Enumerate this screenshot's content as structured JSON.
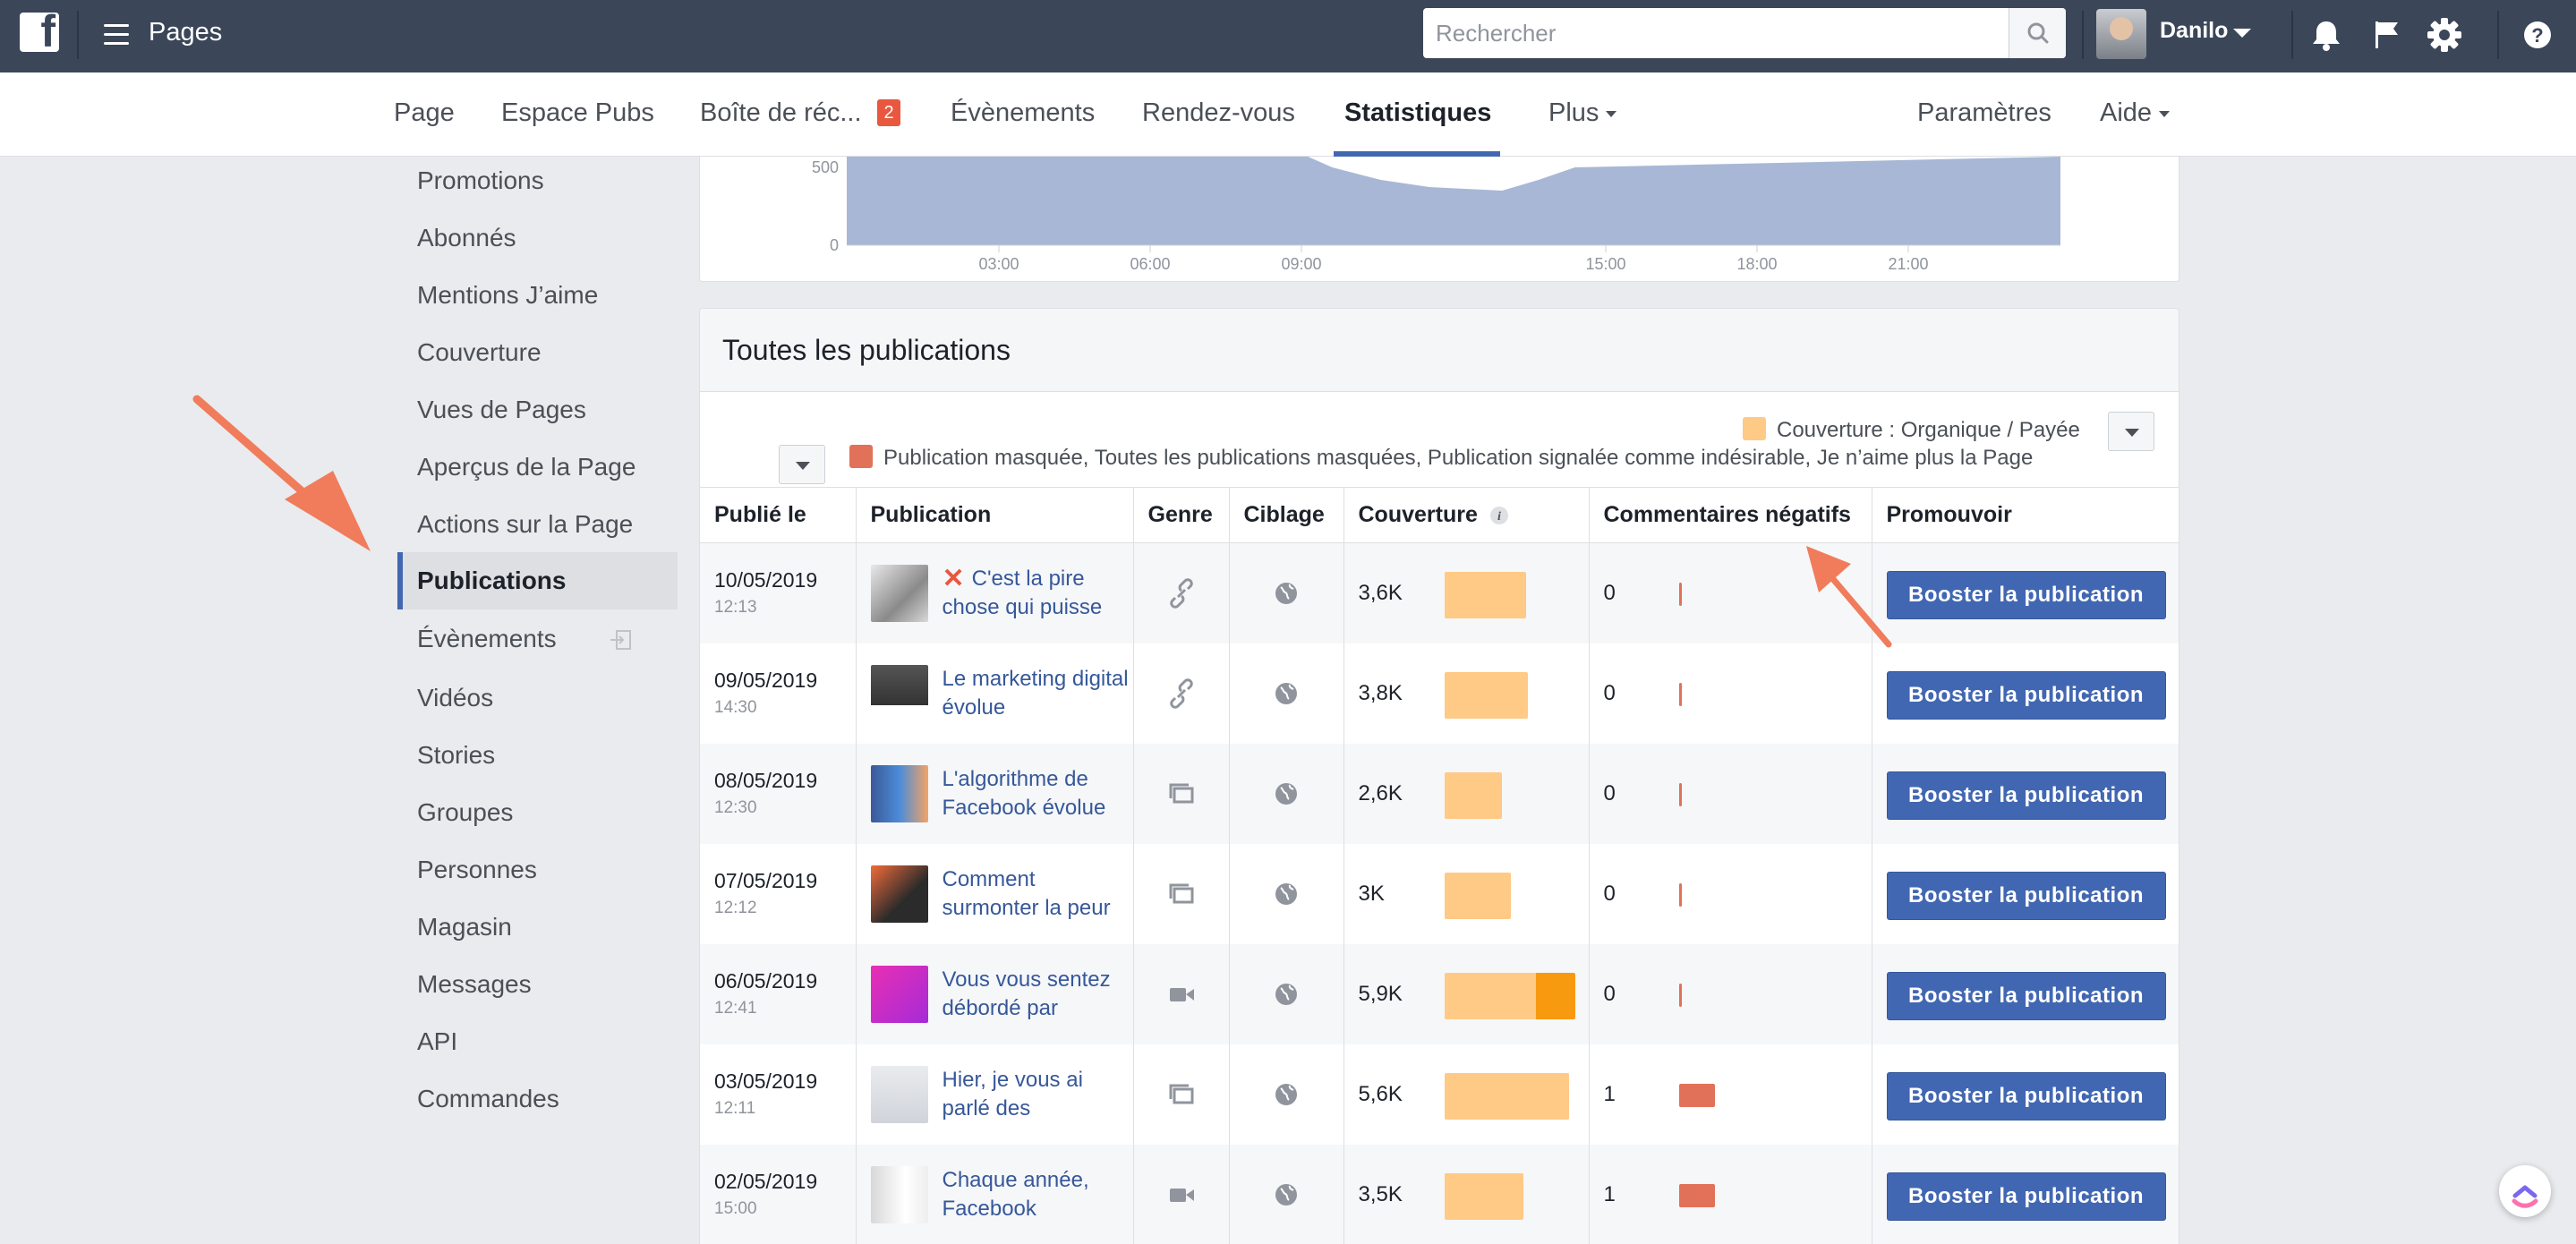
{
  "topbar": {
    "app_title": "Pages",
    "search_placeholder": "Rechercher",
    "username": "Danilo"
  },
  "nav": {
    "tabs": [
      "Page",
      "Espace Pubs",
      "Boîte de réc...",
      "Évènements",
      "Rendez-vous",
      "Statistiques",
      "Plus",
      "Paramètres",
      "Aide"
    ],
    "inbox_badge": "2",
    "active_tab": "Statistiques"
  },
  "sidebar": {
    "items": [
      "Promotions",
      "Abonnés",
      "Mentions J’aime",
      "Couverture",
      "Vues de Pages",
      "Aperçus de la Page",
      "Actions sur la Page",
      "Publications",
      "Évènements",
      "Vidéos",
      "Stories",
      "Groupes",
      "Personnes",
      "Magasin",
      "Messages",
      "API",
      "Commandes"
    ],
    "active": "Publications"
  },
  "chart_data": {
    "type": "area",
    "y_ticks": [
      "500",
      "0"
    ],
    "x_ticks": [
      "03:00",
      "06:00",
      "09:00",
      "15:00",
      "18:00",
      "21:00"
    ]
  },
  "publications": {
    "title": "Toutes les publications",
    "legend_reach": "Couverture : Organique / Payée",
    "legend_negative": "Publication masquée, Toutes les publications masquées, Publication signalée comme indésirable, Je n’aime plus la Page",
    "columns": [
      "Publié le",
      "Publication",
      "Genre",
      "Ciblage",
      "Couverture",
      "Commentaires négatifs",
      "Promouvoir"
    ],
    "boost_label": "Booster la publication",
    "colors": {
      "organic": "#ffc986",
      "paid": "#f79a10",
      "negative": "#e2715a",
      "accent": "#4267b2"
    },
    "rows": [
      {
        "date": "10/05/2019",
        "time": "12:13",
        "text": "C'est la pire chose qui puisse",
        "flagged": true,
        "genre": "link-icon",
        "reach": "3,6K",
        "organic": 0.62,
        "paid": 0,
        "negative": "0",
        "neg_level": 0
      },
      {
        "date": "09/05/2019",
        "time": "14:30",
        "text": "Le marketing digital évolue",
        "flagged": false,
        "genre": "link-icon",
        "reach": "3,8K",
        "organic": 0.64,
        "paid": 0,
        "negative": "0",
        "neg_level": 0
      },
      {
        "date": "08/05/2019",
        "time": "12:30",
        "text": "L'algorithme de Facebook évolue",
        "flagged": false,
        "genre": "album-icon",
        "reach": "2,6K",
        "organic": 0.44,
        "paid": 0,
        "negative": "0",
        "neg_level": 0
      },
      {
        "date": "07/05/2019",
        "time": "12:12",
        "text": "Comment surmonter la peur",
        "flagged": false,
        "genre": "album-icon",
        "reach": "3K",
        "organic": 0.51,
        "paid": 0,
        "negative": "0",
        "neg_level": 0
      },
      {
        "date": "06/05/2019",
        "time": "12:41",
        "text": "Vous vous sentez débordé par",
        "flagged": false,
        "genre": "video-icon",
        "reach": "5,9K",
        "organic": 0.7,
        "paid": 0.3,
        "negative": "0",
        "neg_level": 0
      },
      {
        "date": "03/05/2019",
        "time": "12:11",
        "text": "Hier, je vous ai parlé des",
        "flagged": false,
        "genre": "album-icon",
        "reach": "5,6K",
        "organic": 0.95,
        "paid": 0,
        "negative": "1",
        "neg_level": 1
      },
      {
        "date": "02/05/2019",
        "time": "15:00",
        "text": "Chaque année, Facebook",
        "flagged": false,
        "genre": "video-icon",
        "reach": "3,5K",
        "organic": 0.6,
        "paid": 0,
        "negative": "1",
        "neg_level": 1
      }
    ]
  }
}
